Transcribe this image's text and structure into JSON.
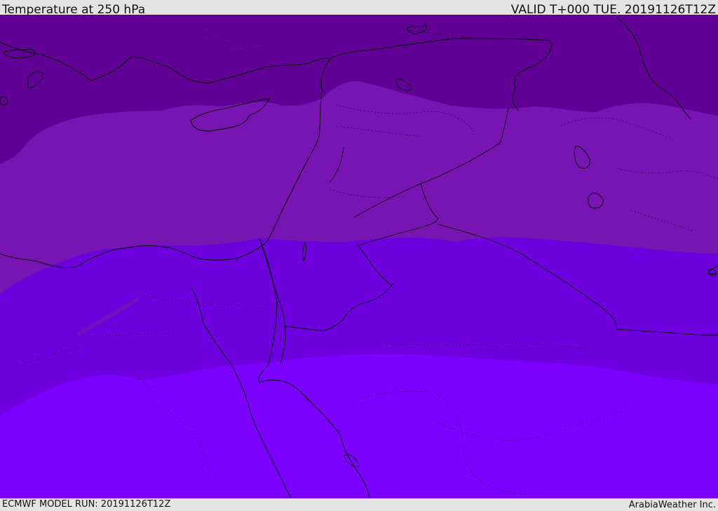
{
  "header": {
    "title": "Temperature at 250 hPa",
    "valid": "VALID T+000 TUE. 20191126T12Z"
  },
  "footer": {
    "model_run": "ECMWF MODEL RUN: 20191126T12Z",
    "credit": "ArabiaWeather Inc."
  },
  "map": {
    "field": "temperature",
    "level": "250 hPa",
    "band_colors": [
      "#600095",
      "#7814b1",
      "#7200cc",
      "#6d00dc",
      "#7b00ff"
    ],
    "boundary_color": "#000000"
  }
}
